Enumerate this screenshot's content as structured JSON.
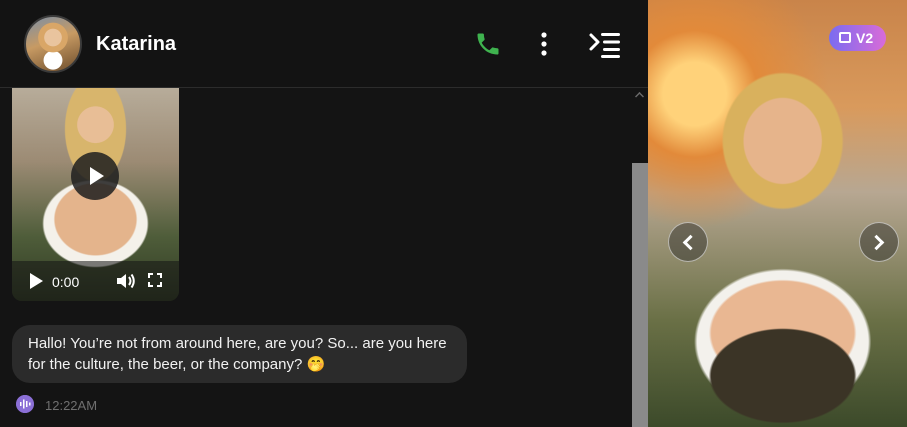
{
  "header": {
    "name": "Katarina",
    "icons": {
      "call": "phone-icon",
      "more": "kebab-menu-icon",
      "panel": "collapse-menu-icon"
    },
    "call_color": "#3fb34f"
  },
  "video": {
    "time": "0:00",
    "icons": {
      "play": "play-icon",
      "volume": "volume-icon",
      "fullscreen": "fullscreen-icon"
    }
  },
  "message": {
    "text": "Hallo! You’re not from around here, are you? So... are you here for the culture, the beer, or the company? 🤭",
    "time": "12:22AM",
    "voice_icon": "voice-wave-icon",
    "bubble_color": "#2b2b2b"
  },
  "gallery": {
    "badge": "V2",
    "badge_icon": "image-icon",
    "prev_icon": "chevron-left-icon",
    "next_icon": "chevron-right-icon",
    "accent": "#8b6fd6"
  }
}
